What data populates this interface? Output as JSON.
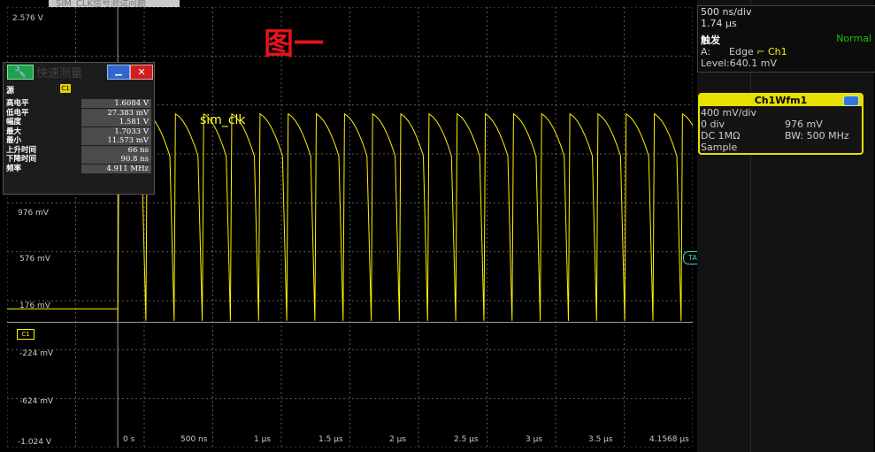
{
  "window": {
    "top_tab_label": "SIM_CLK信号测试问题"
  },
  "annotation": {
    "title": "图一",
    "signal_label": "sim_clk"
  },
  "y_axis_labels": [
    "2.576 V",
    "976 mV",
    "576 mV",
    "176 mV",
    "-224 mV",
    "-624 mV",
    "-1.024 V"
  ],
  "x_axis_labels": [
    "0 s",
    "500 ns",
    "1 µs",
    "1.5 µs",
    "2 µs",
    "2.5 µs",
    "3 µs",
    "3.5 µs",
    "4.1568 µs"
  ],
  "markers": {
    "timebase": "TA",
    "channel": "C1"
  },
  "measurement_panel": {
    "title": "快速测量",
    "source_label": "源",
    "source_value": "C1",
    "tool_icon": "wrench-icon",
    "rows": [
      {
        "name": "高电平",
        "value": "1.6084 V"
      },
      {
        "name": "低电平",
        "value": "27.383 mV"
      },
      {
        "name": "幅度",
        "value": "1.581 V"
      },
      {
        "name": "最大",
        "value": "1.7033 V"
      },
      {
        "name": "最小",
        "value": "11.573 mV"
      },
      {
        "name": "上升时间",
        "value": "66 ns"
      },
      {
        "name": "下降时间",
        "value": "90.8 ns"
      },
      {
        "name": "频率",
        "value": "4.911 MHz"
      }
    ]
  },
  "timebase_panel": {
    "scale": "500 ns/div",
    "position": "1.74 µs",
    "trigger_title": "触发",
    "trigger_mode": "Normal",
    "trigger_source_prefix": "A:",
    "trigger_type": "Edge",
    "trigger_channel": "Ch1",
    "trigger_level": "Level:640.1 mV"
  },
  "channel_panel": {
    "title": "Ch1Wfm1",
    "scale": "400 mV/div",
    "offset_div": "0 div",
    "offset_value": "976 mV",
    "coupling": "DC 1MΩ",
    "bandwidth": "BW: 500 MHz",
    "acq_mode": "Sample"
  },
  "colors": {
    "trace": "#fff200",
    "grid": "#5a5a5a",
    "alert_red": "#e4141b",
    "accent_cyan": "#3bd2c5"
  },
  "chart_data": {
    "type": "line",
    "series": [
      {
        "name": "sim_clk",
        "frequency_mhz": 4.911,
        "high_v": 1.6084,
        "low_v": 0.027383,
        "max_v": 1.7033,
        "min_v": 0.011573,
        "start_s": 0.0
      }
    ],
    "xlim": [
      -8e-07,
      4.1568e-06
    ],
    "ylim": [
      -1.024,
      2.576
    ]
  }
}
